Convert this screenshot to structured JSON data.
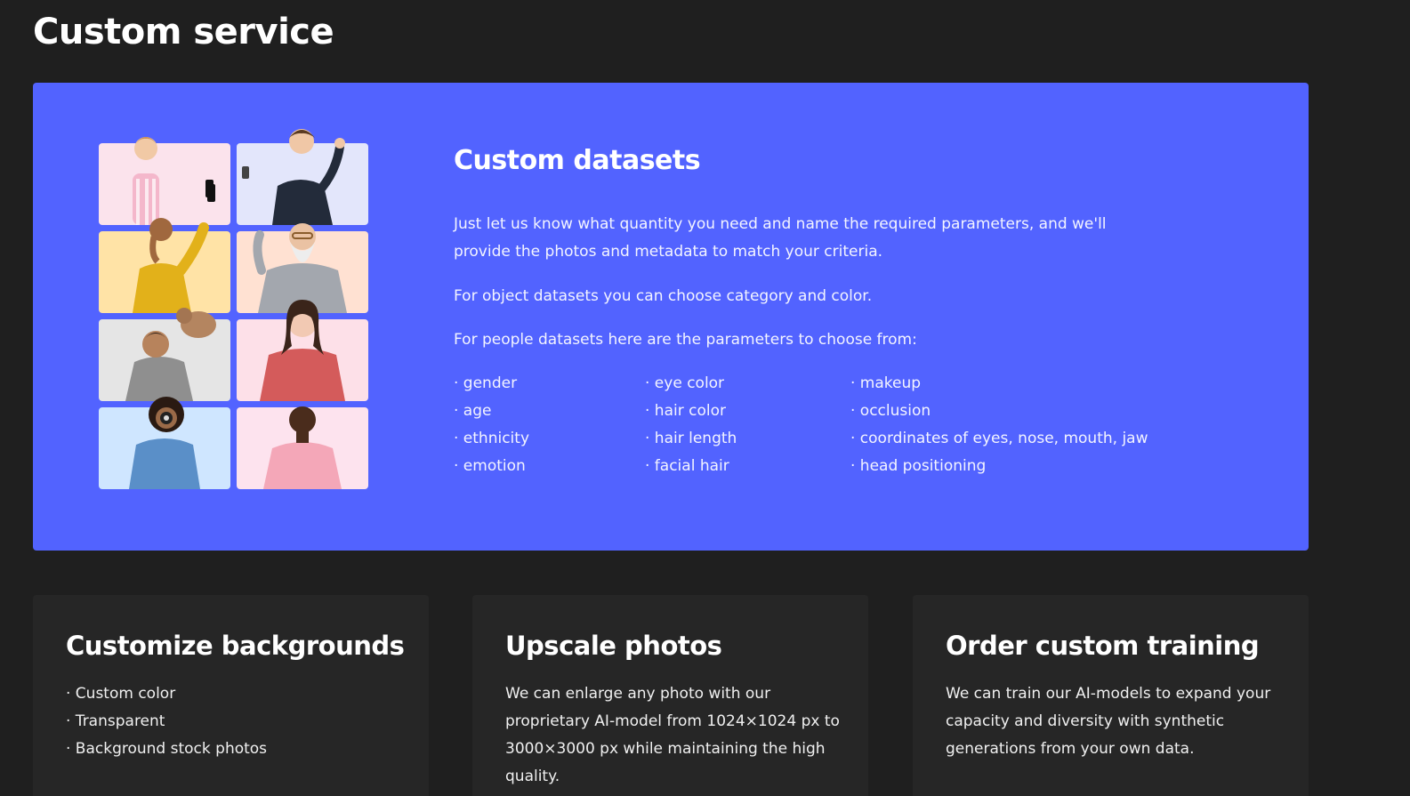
{
  "page": {
    "title": "Custom service"
  },
  "hero": {
    "heading": "Custom datasets",
    "paragraphs": [
      "Just let us know what quantity you need and name the required parameters, and we'll provide the photos and metadata to match your criteria.",
      "For object datasets you can choose category and color.",
      "For people datasets here are the parameters to choose from:"
    ],
    "parameters": [
      [
        "· gender",
        "· age",
        "· ethnicity",
        "· emotion"
      ],
      [
        "· eye color",
        "· hair color",
        "· hair length",
        "· facial hair"
      ],
      [
        "· makeup",
        "· occlusion",
        "· coordinates of eyes, nose, mouth, jaw",
        "· head positioning"
      ]
    ],
    "photo_backgrounds": [
      "#fbe3ec",
      "#e3e6fb",
      "#ffe3a6",
      "#ffe1d2",
      "#e5e5e5",
      "#fde0e8",
      "#cfe6ff",
      "#fde3ee"
    ]
  },
  "cards": [
    {
      "title": "Customize backgrounds",
      "lines": [
        "· Custom color",
        "· Transparent",
        "· Background stock photos"
      ]
    },
    {
      "title": "Upscale photos",
      "lines": [
        "We can enlarge any photo with our",
        "proprietary AI-model from 1024×1024 px to",
        "3000×3000 px while maintaining the high",
        "quality."
      ]
    },
    {
      "title": "Order custom training",
      "lines": [
        "We can train our AI-models to expand your",
        "capacity and diversity with synthetic",
        "generations from your own data."
      ]
    }
  ],
  "colors": {
    "page_background": "#1f1f1f",
    "hero_background": "#5263ff",
    "card_background": "#262626",
    "text": "#ffffff"
  }
}
